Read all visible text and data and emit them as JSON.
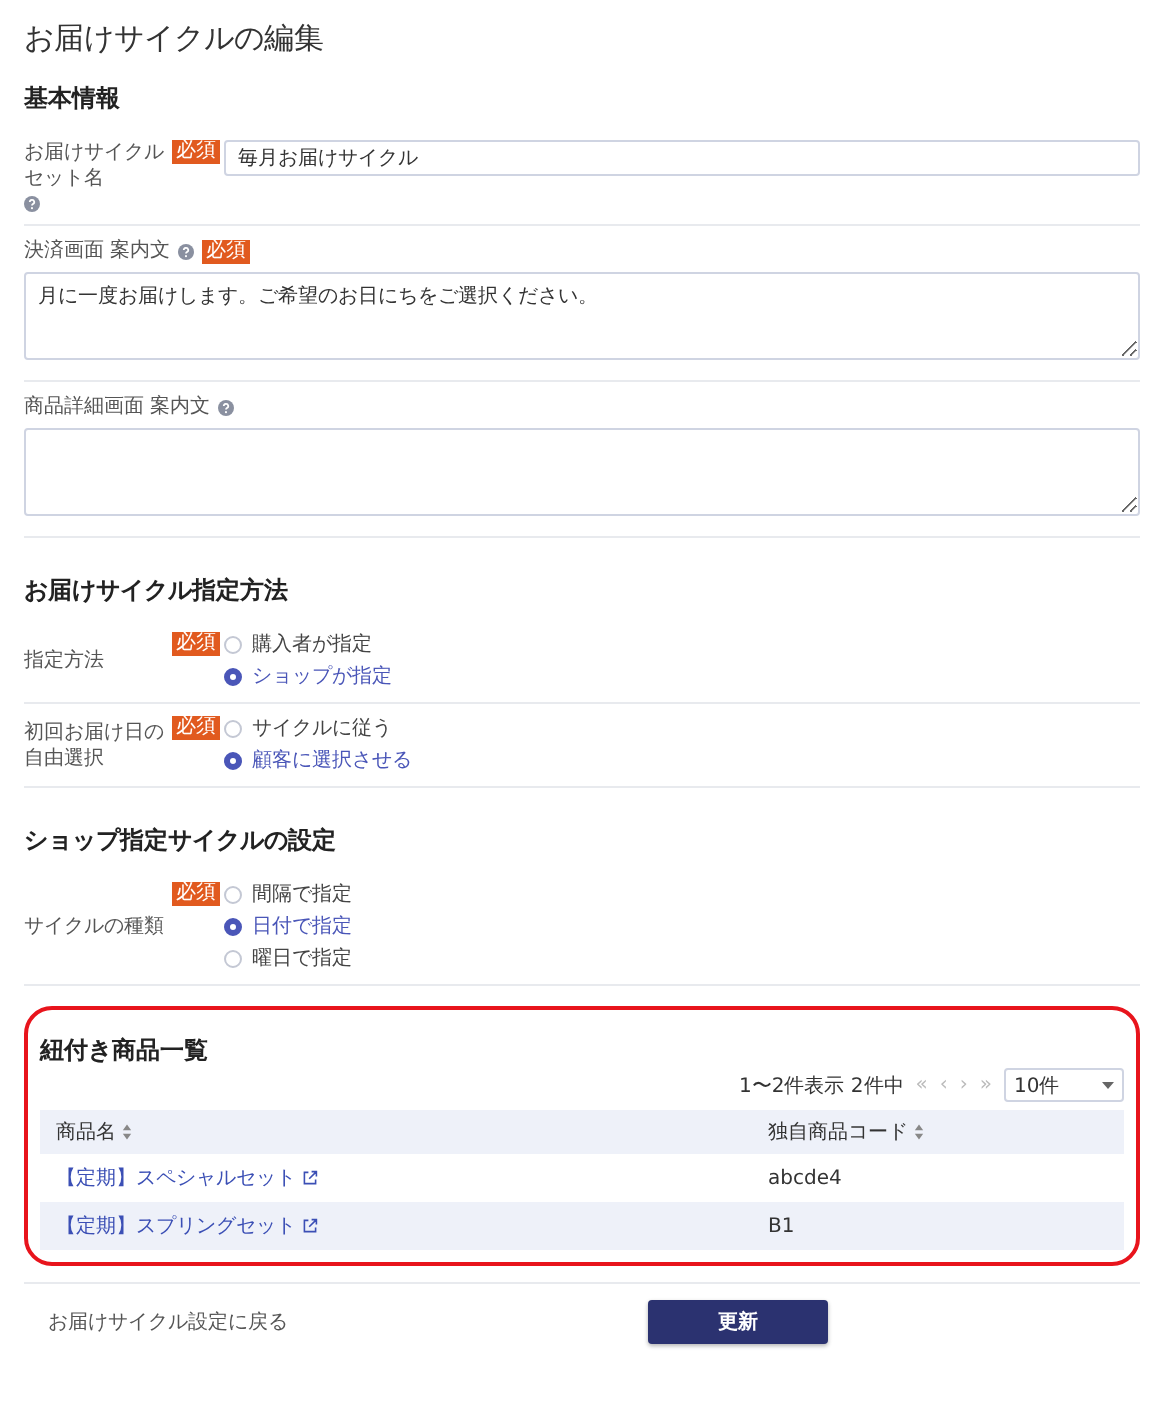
{
  "page_title": "お届けサイクルの編集",
  "form_sections": [
    {
      "title": "基本情報",
      "fields": [
        {
          "kind": "input",
          "label": "お届けサイクルセット名",
          "badge": "必須",
          "help": true,
          "value": "毎月お届けサイクル"
        },
        {
          "kind": "textarea",
          "label": "決済画面 案内文",
          "badge": "必須",
          "help": true,
          "value": "月に一度お届けします。ご希望のお日にちをご選択ください。"
        },
        {
          "kind": "textarea",
          "label": "商品詳細画面 案内文",
          "help": true
        }
      ]
    },
    {
      "title": "お届けサイクル指定方法",
      "fields": [
        {
          "kind": "radio",
          "label": "指定方法",
          "badge": "必須",
          "options": [
            {
              "label": "購入者が指定",
              "selected": false
            },
            {
              "label": "ショップが指定",
              "selected": true
            }
          ]
        },
        {
          "kind": "radio",
          "label": "初回お届け日の自由選択",
          "badge": "必須",
          "options": [
            {
              "label": "サイクルに従う",
              "selected": false
            },
            {
              "label": "顧客に選択させる",
              "selected": true
            }
          ]
        }
      ]
    },
    {
      "title": "ショップ指定サイクルの設定",
      "fields": [
        {
          "kind": "radio",
          "label": "サイクルの種類",
          "badge": "必須",
          "options": [
            {
              "label": "間隔で指定",
              "selected": false
            },
            {
              "label": "日付で指定",
              "selected": true
            },
            {
              "label": "曜日で指定",
              "selected": false
            }
          ]
        }
      ]
    }
  ],
  "linked_products": {
    "title": "紐付き商品一覧",
    "count_text": "1〜2件表示 2件中",
    "pager": [
      "«",
      "‹",
      "›",
      "»"
    ],
    "per_page": "10件",
    "columns": [
      "商品名",
      "独自商品コード"
    ],
    "rows": [
      {
        "name": "【定期】スペシャルセット",
        "code": "abcde4"
      },
      {
        "name": "【定期】スプリングセット",
        "code": "B1"
      }
    ]
  },
  "footer": {
    "back_link": "お届けサイクル設定に戻る",
    "submit_button": "更新"
  }
}
